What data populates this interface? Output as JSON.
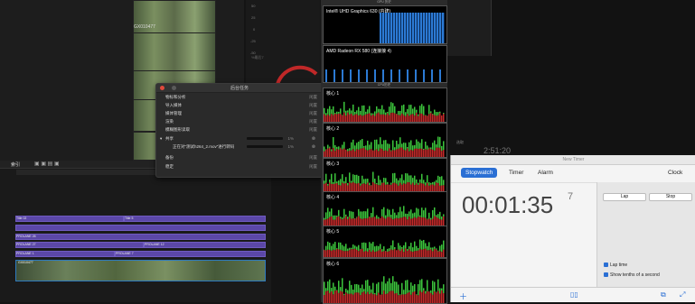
{
  "browser": {
    "clip_label": "GX010477"
  },
  "monitor": {
    "axis_labels": [
      "50",
      "25",
      "0",
      "-25",
      "-50"
    ],
    "footer_label": "%最后7"
  },
  "background_tasks": {
    "title": "后台任务",
    "tasks": [
      {
        "label": "物标和分析",
        "status": "闲置"
      },
      {
        "label": "导入媒体",
        "status": "闲置"
      },
      {
        "label": "媒体管理",
        "status": "闲置"
      },
      {
        "label": "渲染",
        "status": "闲置"
      },
      {
        "label": "模糊图形读取",
        "status": "闲置"
      },
      {
        "label": "共享",
        "status": "1%"
      },
      {
        "label": "正在对“测试h264_2.mov”进行转码",
        "status": "1%"
      },
      {
        "label": "备份",
        "status": "闲置"
      },
      {
        "label": "稳定",
        "status": "闲置"
      }
    ]
  },
  "timeline": {
    "index_label": "索引",
    "lanes": [
      {
        "label": "Title 02"
      },
      {
        "label": "Title 5"
      },
      {
        "label": "PROLANE 26"
      },
      {
        "label": "PROLANE 27"
      },
      {
        "label": "PROLANE 12"
      },
      {
        "label": "PROLANE 1"
      },
      {
        "label": "PROLANE 7"
      },
      {
        "label": "GX010477"
      }
    ]
  },
  "cpu_monitor": {
    "gpu_title": "GPU 历史",
    "cpu_title": "CPU历史",
    "gpus": [
      "Intel® UHD Graphics 630 (内建)",
      "AMD Radeon RX 580 (连接接 4)"
    ],
    "cores": [
      "核心 1",
      "核心 2",
      "核心 3",
      "核心 4",
      "核心 5",
      "核心 6"
    ]
  },
  "clock_overlay": {
    "time": "2:51:20",
    "label": "选取"
  },
  "timer_app": {
    "window_title": "New Timer",
    "tabs": [
      "Stopwatch",
      "Timer",
      "Alarm"
    ],
    "clock_tab": "Clock",
    "time": "00:01:35",
    "tenths": "7",
    "lap_button": "Lap",
    "stop_button": "Stop",
    "options": [
      "Lap time",
      "Show tenths of a second"
    ],
    "accent_color": "#2a6fd4"
  }
}
